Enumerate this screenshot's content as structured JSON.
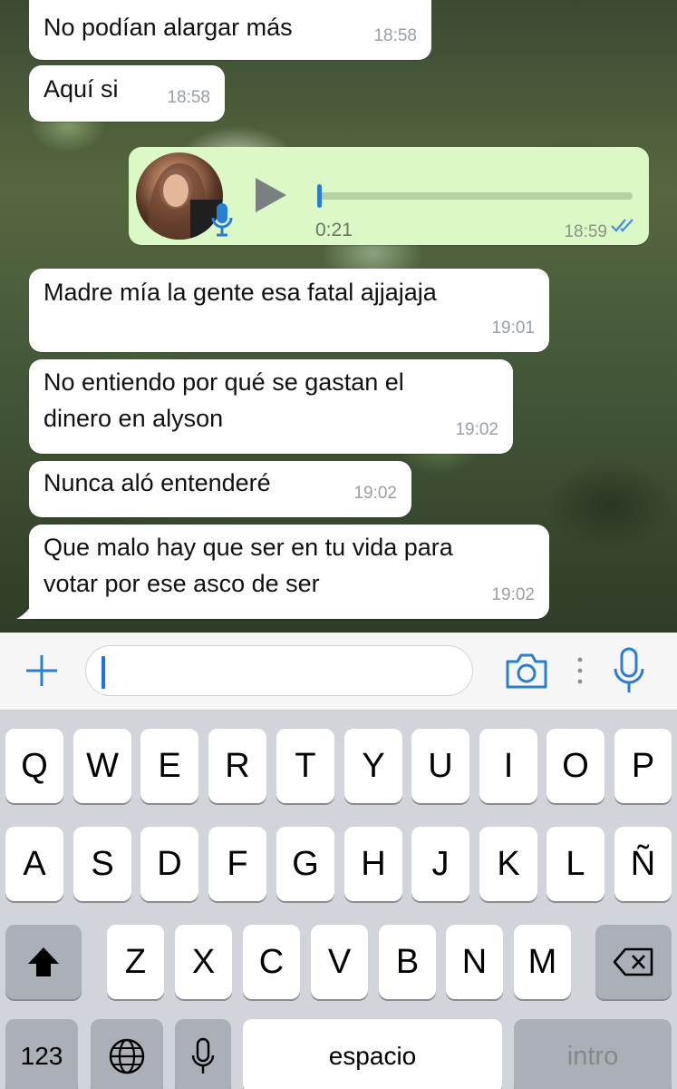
{
  "chat": {
    "messages": [
      {
        "text": "No podían alargar más",
        "time": "18:58"
      },
      {
        "text": "Aquí si",
        "time": "18:58"
      },
      {
        "type": "voice",
        "duration": "0:21",
        "time": "18:59",
        "progress": 0.0
      },
      {
        "text": "Madre mía la gente esa fatal ajjajaja",
        "time": "19:01"
      },
      {
        "text": "No entiendo por qué se gastan el\ndinero en alyson",
        "time": "19:02"
      },
      {
        "text": "Nunca aló entenderé",
        "time": "19:02"
      },
      {
        "text": "Que malo hay que ser en tu vida para\nvotar por ese asco de ser",
        "time": "19:02"
      }
    ]
  },
  "input_bar": {
    "message_value": "",
    "icons": [
      "plus-icon",
      "camera-icon",
      "more-dots-icon",
      "microphone-icon"
    ]
  },
  "keyboard": {
    "row1": [
      "Q",
      "W",
      "E",
      "R",
      "T",
      "Y",
      "U",
      "I",
      "O",
      "P"
    ],
    "row2": [
      "A",
      "S",
      "D",
      "F",
      "G",
      "H",
      "J",
      "K",
      "L",
      "Ñ"
    ],
    "row3": [
      "Z",
      "X",
      "C",
      "V",
      "B",
      "N",
      "M"
    ],
    "numbers_label": "123",
    "space_label": "espacio",
    "return_label": "intro",
    "icons": [
      "shift-icon",
      "backspace-icon",
      "globe-icon",
      "dictation-mic-icon"
    ]
  },
  "colors": {
    "incoming_bubble": "#ffffff",
    "outgoing_bubble": "#dcf8c6",
    "accent": "#2b7cd3"
  }
}
